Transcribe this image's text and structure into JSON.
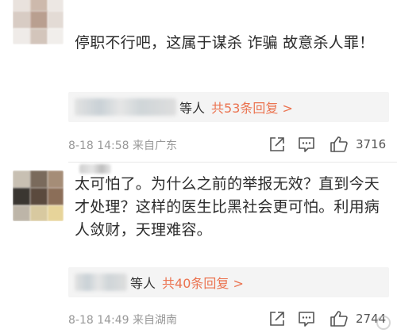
{
  "comments": [
    {
      "text": "停职不行吧，这属于谋杀 诈骗 故意杀人罪！",
      "replies_suffix": "等人",
      "replies_link": "共53条回复 >",
      "time": "8-18 14:58 来自广东",
      "likes": "3716"
    },
    {
      "text": "太可怕了。为什么之前的举报无效？直到今天才处理？这样的医生比黑社会更可怕。利用病人敛财，天理难容。",
      "replies_suffix": "等人",
      "replies_link": "共40条回复 >",
      "time": "8-18 14:49 来自湖南",
      "likes": "2744"
    }
  ],
  "icons": {
    "share": "share-icon",
    "comment": "comment-icon",
    "like": "thumbs-up-icon"
  },
  "colors": {
    "accent": "#eb7350",
    "text": "#333333",
    "meta": "#999999",
    "reply_bg": "#f4f4f4"
  }
}
